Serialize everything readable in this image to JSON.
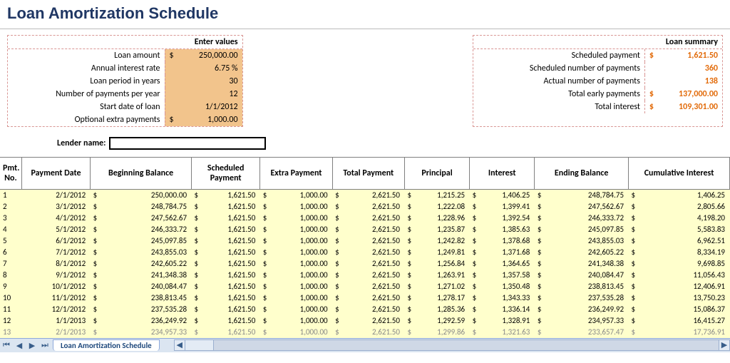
{
  "title": "Loan Amortization Schedule",
  "enter_values": {
    "header": "Enter values",
    "rows": [
      {
        "label": "Loan amount",
        "cur": "$",
        "value": "250,000.00"
      },
      {
        "label": "Annual interest rate",
        "cur": "",
        "value": "6.75  %"
      },
      {
        "label": "Loan period in years",
        "cur": "",
        "value": "30"
      },
      {
        "label": "Number of payments per year",
        "cur": "",
        "value": "12"
      },
      {
        "label": "Start date of loan",
        "cur": "",
        "value": "1/1/2012"
      },
      {
        "label": "Optional extra payments",
        "cur": "$",
        "value": "1,000.00"
      }
    ]
  },
  "loan_summary": {
    "header": "Loan summary",
    "rows": [
      {
        "label": "Scheduled payment",
        "cur": "$",
        "value": "1,621.50"
      },
      {
        "label": "Scheduled number of payments",
        "cur": "",
        "value": "360"
      },
      {
        "label": "Actual number of payments",
        "cur": "",
        "value": "138"
      },
      {
        "label": "Total early payments",
        "cur": "$",
        "value": "137,000.00"
      },
      {
        "label": "Total interest",
        "cur": "$",
        "value": "109,301.00"
      }
    ]
  },
  "lender": {
    "label": "Lender name:",
    "value": ""
  },
  "schedule": {
    "headers": [
      "Pmt. No.",
      "Payment Date",
      "Beginning Balance",
      "Scheduled Payment",
      "Extra Payment",
      "Total Payment",
      "Principal",
      "Interest",
      "Ending Balance",
      "Cumulative Interest"
    ],
    "widths": [
      30,
      95,
      140,
      95,
      100,
      100,
      90,
      90,
      130,
      140
    ],
    "rows": [
      {
        "n": "1",
        "date": "2/1/2012",
        "beg": "250,000.00",
        "sched": "1,621.50",
        "extra": "1,000.00",
        "total": "2,621.50",
        "prin": "1,215.25",
        "int": "1,406.25",
        "end": "248,784.75",
        "cum": "1,406.25"
      },
      {
        "n": "2",
        "date": "3/1/2012",
        "beg": "248,784.75",
        "sched": "1,621.50",
        "extra": "1,000.00",
        "total": "2,621.50",
        "prin": "1,222.08",
        "int": "1,399.41",
        "end": "247,562.67",
        "cum": "2,805.66"
      },
      {
        "n": "3",
        "date": "4/1/2012",
        "beg": "247,562.67",
        "sched": "1,621.50",
        "extra": "1,000.00",
        "total": "2,621.50",
        "prin": "1,228.96",
        "int": "1,392.54",
        "end": "246,333.72",
        "cum": "4,198.20"
      },
      {
        "n": "4",
        "date": "5/1/2012",
        "beg": "246,333.72",
        "sched": "1,621.50",
        "extra": "1,000.00",
        "total": "2,621.50",
        "prin": "1,235.87",
        "int": "1,385.63",
        "end": "245,097.85",
        "cum": "5,583.83"
      },
      {
        "n": "5",
        "date": "6/1/2012",
        "beg": "245,097.85",
        "sched": "1,621.50",
        "extra": "1,000.00",
        "total": "2,621.50",
        "prin": "1,242.82",
        "int": "1,378.68",
        "end": "243,855.03",
        "cum": "6,962.51"
      },
      {
        "n": "6",
        "date": "7/1/2012",
        "beg": "243,855.03",
        "sched": "1,621.50",
        "extra": "1,000.00",
        "total": "2,621.50",
        "prin": "1,249.81",
        "int": "1,371.68",
        "end": "242,605.22",
        "cum": "8,334.19"
      },
      {
        "n": "7",
        "date": "8/1/2012",
        "beg": "242,605.22",
        "sched": "1,621.50",
        "extra": "1,000.00",
        "total": "2,621.50",
        "prin": "1,256.84",
        "int": "1,364.65",
        "end": "241,348.38",
        "cum": "9,698.85"
      },
      {
        "n": "8",
        "date": "9/1/2012",
        "beg": "241,348.38",
        "sched": "1,621.50",
        "extra": "1,000.00",
        "total": "2,621.50",
        "prin": "1,263.91",
        "int": "1,357.58",
        "end": "240,084.47",
        "cum": "11,056.43"
      },
      {
        "n": "9",
        "date": "10/1/2012",
        "beg": "240,084.47",
        "sched": "1,621.50",
        "extra": "1,000.00",
        "total": "2,621.50",
        "prin": "1,271.02",
        "int": "1,350.48",
        "end": "238,813.45",
        "cum": "12,406.91"
      },
      {
        "n": "10",
        "date": "11/1/2012",
        "beg": "238,813.45",
        "sched": "1,621.50",
        "extra": "1,000.00",
        "total": "2,621.50",
        "prin": "1,278.17",
        "int": "1,343.33",
        "end": "237,535.28",
        "cum": "13,750.23"
      },
      {
        "n": "11",
        "date": "12/1/2012",
        "beg": "237,535.28",
        "sched": "1,621.50",
        "extra": "1,000.00",
        "total": "2,621.50",
        "prin": "1,285.36",
        "int": "1,336.14",
        "end": "236,249.92",
        "cum": "15,086.37"
      },
      {
        "n": "12",
        "date": "1/1/2013",
        "beg": "236,249.92",
        "sched": "1,621.50",
        "extra": "1,000.00",
        "total": "2,621.50",
        "prin": "1,292.59",
        "int": "1,328.91",
        "end": "234,957.33",
        "cum": "16,415.27"
      },
      {
        "n": "13",
        "date": "2/1/2013",
        "beg": "234,957.33",
        "sched": "1,621.50",
        "extra": "1,000.00",
        "total": "2,621.50",
        "prin": "1,299.86",
        "int": "1,321.63",
        "end": "233,657.47",
        "cum": "17,736.91"
      }
    ]
  },
  "tabbar": {
    "tab": "Loan Amortization Schedule",
    "nav": [
      "⏮",
      "◀",
      "▶",
      "⏭"
    ]
  },
  "chart_data": {
    "type": "table",
    "title": "Loan Amortization Schedule",
    "inputs": {
      "loan_amount": 250000.0,
      "annual_interest_rate_pct": 6.75,
      "loan_period_years": 30,
      "payments_per_year": 12,
      "start_date": "2012-01-01",
      "optional_extra_payment": 1000.0
    },
    "summary": {
      "scheduled_payment": 1621.5,
      "scheduled_number_of_payments": 360,
      "actual_number_of_payments": 138,
      "total_early_payments": 137000.0,
      "total_interest": 109301.0
    },
    "columns": [
      "pmt_no",
      "payment_date",
      "beginning_balance",
      "scheduled_payment",
      "extra_payment",
      "total_payment",
      "principal",
      "interest",
      "ending_balance",
      "cumulative_interest"
    ],
    "rows": [
      [
        1,
        "2012-02-01",
        250000.0,
        1621.5,
        1000.0,
        2621.5,
        1215.25,
        1406.25,
        248784.75,
        1406.25
      ],
      [
        2,
        "2012-03-01",
        248784.75,
        1621.5,
        1000.0,
        2621.5,
        1222.08,
        1399.41,
        247562.67,
        2805.66
      ],
      [
        3,
        "2012-04-01",
        247562.67,
        1621.5,
        1000.0,
        2621.5,
        1228.96,
        1392.54,
        246333.72,
        4198.2
      ],
      [
        4,
        "2012-05-01",
        246333.72,
        1621.5,
        1000.0,
        2621.5,
        1235.87,
        1385.63,
        245097.85,
        5583.83
      ],
      [
        5,
        "2012-06-01",
        245097.85,
        1621.5,
        1000.0,
        2621.5,
        1242.82,
        1378.68,
        243855.03,
        6962.51
      ],
      [
        6,
        "2012-07-01",
        243855.03,
        1621.5,
        1000.0,
        2621.5,
        1249.81,
        1371.68,
        242605.22,
        8334.19
      ],
      [
        7,
        "2012-08-01",
        242605.22,
        1621.5,
        1000.0,
        2621.5,
        1256.84,
        1364.65,
        241348.38,
        9698.85
      ],
      [
        8,
        "2012-09-01",
        241348.38,
        1621.5,
        1000.0,
        2621.5,
        1263.91,
        1357.58,
        240084.47,
        11056.43
      ],
      [
        9,
        "2012-10-01",
        240084.47,
        1621.5,
        1000.0,
        2621.5,
        1271.02,
        1350.48,
        238813.45,
        12406.91
      ],
      [
        10,
        "2012-11-01",
        238813.45,
        1621.5,
        1000.0,
        2621.5,
        1278.17,
        1343.33,
        237535.28,
        13750.23
      ],
      [
        11,
        "2012-12-01",
        237535.28,
        1621.5,
        1000.0,
        2621.5,
        1285.36,
        1336.14,
        236249.92,
        15086.37
      ],
      [
        12,
        "2013-01-01",
        236249.92,
        1621.5,
        1000.0,
        2621.5,
        1292.59,
        1328.91,
        234957.33,
        16415.27
      ],
      [
        13,
        "2013-02-01",
        234957.33,
        1621.5,
        1000.0,
        2621.5,
        1299.86,
        1321.63,
        233657.47,
        17736.91
      ]
    ]
  }
}
